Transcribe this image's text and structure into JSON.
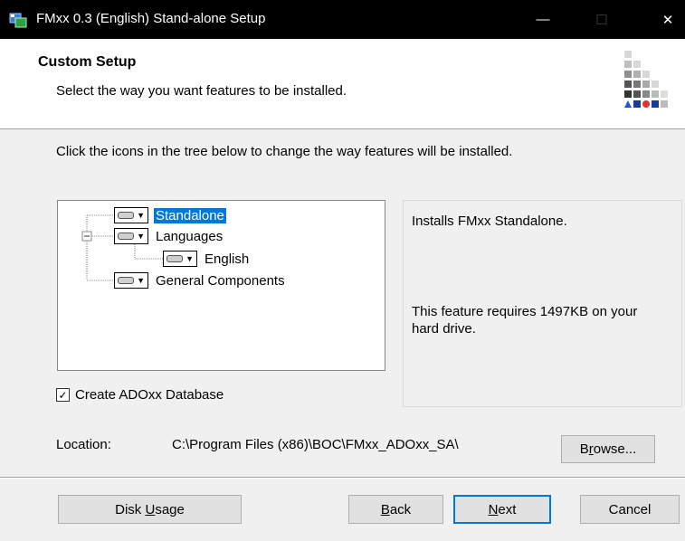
{
  "window": {
    "title": "FMxx 0.3 (English) Stand-alone Setup",
    "minimize": "—",
    "maximize": "☐",
    "close": "✕"
  },
  "header": {
    "title": "Custom Setup",
    "subtitle": "Select the way you want features to be installed."
  },
  "instructions": "Click the icons in the tree below to change the way features will be installed.",
  "tree": {
    "items": [
      {
        "label": "Standalone",
        "selected": true,
        "icon": "drive-icon"
      },
      {
        "label": "Languages",
        "expanded": true,
        "icon": "drive-icon"
      },
      {
        "label": "English",
        "icon": "drive-icon"
      },
      {
        "label": "General Components",
        "icon": "drive-icon"
      }
    ]
  },
  "info": {
    "description": "Installs FMxx Standalone.",
    "requirement": "This feature requires 1497KB on your hard drive."
  },
  "checkbox": {
    "label": "Create ADOxx Database",
    "checked": true
  },
  "location": {
    "label": "Location:",
    "path": "C:\\Program Files (x86)\\BOC\\FMxx_ADOxx_SA\\"
  },
  "buttons": {
    "browse": {
      "pre": "B",
      "ul": "r",
      "post": "owse..."
    },
    "disk_usage": {
      "pre": "Disk ",
      "ul": "U",
      "post": "sage"
    },
    "back": {
      "pre": "",
      "ul": "B",
      "post": "ack"
    },
    "next": {
      "pre": "",
      "ul": "N",
      "post": "ext"
    },
    "cancel": {
      "pre": "Cancel",
      "ul": "",
      "post": ""
    }
  },
  "colors": {
    "selection": "#0078d7",
    "titlebar": "#000000"
  }
}
